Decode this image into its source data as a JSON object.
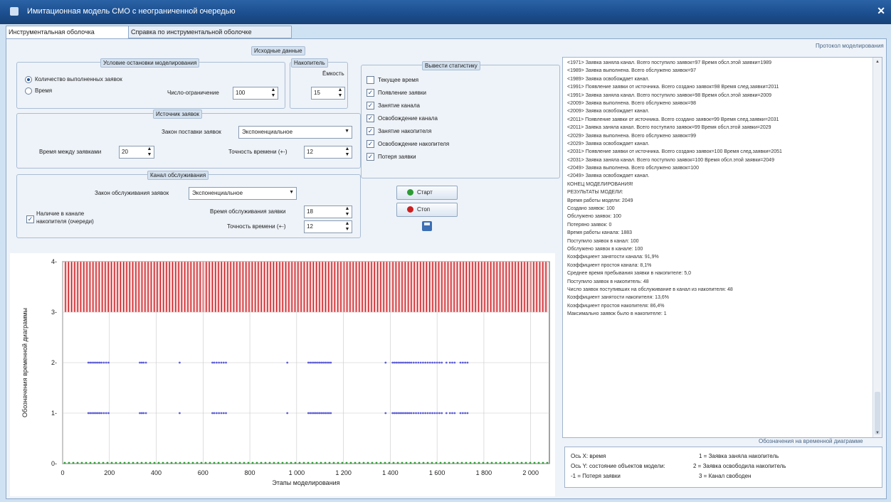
{
  "window": {
    "title": "Имитационная модель СМО с неограниченной очередью",
    "close": "✕"
  },
  "tabs": [
    "Инструментальная оболочка",
    "Справка по инструментальной оболочке"
  ],
  "input_section_title": "Исходные данные",
  "stop_condition": {
    "title": "Условие остановки моделирования",
    "option1": "Количество выполненных заявок",
    "option2": "Время",
    "limit_label": "Число-ограничение",
    "limit_value": "100"
  },
  "accumulator": {
    "title": "Накопитель",
    "capacity_label": "Ёмкость",
    "capacity_value": "15"
  },
  "source": {
    "title": "Источник заявок",
    "law_label": "Закон поставки заявок",
    "law_value": "Экспоненциальное",
    "interval_label": "Время между заявками",
    "interval_value": "20",
    "precision_label": "Точность времени (+-)",
    "precision_value": "12"
  },
  "channel": {
    "title": "Канал обслуживания",
    "law_label": "Закон обслуживания заявок",
    "law_value": "Экспоненциальное",
    "accumulator_check": "Наличие в канале накопителя (очереди)",
    "service_time_label": "Время обслуживания заявки",
    "service_time_value": "18",
    "precision_label": "Точность времени (+-)",
    "precision_value": "12"
  },
  "stats": {
    "title": "Вывести статистику",
    "items": [
      {
        "label": "Текущее время",
        "checked": false
      },
      {
        "label": "Появление заявки",
        "checked": true
      },
      {
        "label": "Занятие канала",
        "checked": true
      },
      {
        "label": "Освобождение канала",
        "checked": true
      },
      {
        "label": "Занятие накопителя",
        "checked": true
      },
      {
        "label": "Освобождение накопителя",
        "checked": true
      },
      {
        "label": "Потеря заявки",
        "checked": true
      }
    ]
  },
  "buttons": {
    "start": "Старт",
    "stop": "Стоп"
  },
  "log": {
    "title": "Протокол моделирования",
    "lines": [
      "<1971> Заявка заняла канал. Всего поступило заявок=97 Время обсл.этой заявки=1989",
      "<1989> Заявка выполнена. Всего обслужено заявок=97",
      "<1989> Заявка освобождает канал.",
      "<1991> Появление заявки от источника. Всего создано заявок=98 Время след.заявки=2011",
      "<1991> Заявка заняла канал. Всего поступило заявок=98 Время обсл.этой заявки=2009",
      "<2009> Заявка выполнена. Всего обслужено заявок=98",
      "<2009> Заявка освобождает канал.",
      "<2011> Появление заявки от источника. Всего создано заявок=99 Время след.заявки=2031",
      "<2011> Заявка заняла канал. Всего поступило заявок=99 Время обсл.этой заявки=2029",
      "<2029> Заявка выполнена. Всего обслужено заявок=99",
      "<2029> Заявка освобождает канал.",
      "<2031> Появление заявки от источника. Всего создано заявок=100 Время след.заявки=2051",
      "<2031> Заявка заняла канал. Всего поступило заявок=100 Время обсл.этой заявки=2049",
      "<2049> Заявка выполнена. Всего обслужено заявок=100",
      "<2049> Заявка освобождает канал.",
      "КОНЕЦ МОДЕЛИРОВАНИЯ!",
      "РЕЗУЛЬТАТЫ МОДЕЛИ:",
      "Время работы модели: 2049",
      "Создано заявок: 100",
      "Обслужено заявок: 100",
      "Потеряно заявок: 0",
      "Время работы канала: 1883",
      "Поступило заявок в канал: 100",
      "Обслужено заявок в канале: 100",
      "Коэффициент занятости канала: 91,9%",
      "Коэффициент простоя канала: 8,1%",
      "Среднее время пребывания заявки в накопителе: 5,0",
      "Поступило заявок в накопитель: 48",
      "Число заявок поступивших на обслуживание в канал из накопителя: 48",
      "Коэффициент занятости накопителя: 13,6%",
      "Коэффициент простоя накопителя: 86,4%",
      "Максимально заявок было в накопителе: 1"
    ]
  },
  "diagram_legend": {
    "title": "Обозначения на временной диаграмме",
    "left": [
      "Ось X: время",
      "Ось Y: состояние объектов модели:",
      "-1 = Потеря заявки"
    ],
    "right": [
      "1 = Заявка заняла накопитель",
      "2 = Заявка освободила накопитель",
      "3 = Канал свободен"
    ]
  },
  "chart_data": {
    "type": "scatter",
    "xlabel": "Этапы моделирования",
    "ylabel": "Обозначения временной диаграммы",
    "xlim": [
      0,
      2080
    ],
    "ylim": [
      0,
      4
    ],
    "x_ticks": [
      "0",
      "200",
      "400",
      "600",
      "800",
      "1 000",
      "1 200",
      "1 400",
      "1 600",
      "1 800",
      "2 000"
    ],
    "y_ticks": [
      "0",
      "1",
      "2",
      "3",
      "4"
    ],
    "grid": true,
    "colors": {
      "channel": "#c9151b",
      "accumulator": "#5f5fd8",
      "zero": "#2f9a35"
    },
    "series": [
      {
        "y": 2,
        "x": [
          110,
          118,
          126,
          134,
          142,
          150,
          158,
          166,
          176,
          186,
          196,
          330,
          338,
          346,
          356,
          500,
          640,
          648,
          658,
          668,
          678,
          688,
          698,
          960,
          1050,
          1058,
          1066,
          1074,
          1082,
          1090,
          1098,
          1106,
          1114,
          1122,
          1130,
          1138,
          1146,
          1380,
          1410,
          1418,
          1426,
          1434,
          1442,
          1450,
          1458,
          1466,
          1474,
          1482,
          1490,
          1500,
          1510,
          1520,
          1530,
          1540,
          1550,
          1560,
          1570,
          1580,
          1590,
          1600,
          1610,
          1620,
          1640,
          1655,
          1665,
          1675,
          1700,
          1710,
          1720,
          1730
        ]
      },
      {
        "y": 1,
        "x": [
          110,
          118,
          126,
          134,
          142,
          150,
          158,
          166,
          176,
          186,
          196,
          330,
          338,
          346,
          356,
          500,
          640,
          648,
          658,
          668,
          678,
          688,
          698,
          960,
          1050,
          1058,
          1066,
          1074,
          1082,
          1090,
          1098,
          1106,
          1114,
          1122,
          1130,
          1138,
          1146,
          1380,
          1410,
          1418,
          1426,
          1434,
          1442,
          1450,
          1458,
          1466,
          1474,
          1482,
          1490,
          1500,
          1510,
          1520,
          1530,
          1540,
          1550,
          1560,
          1570,
          1580,
          1590,
          1600,
          1610,
          1620,
          1640,
          1655,
          1665,
          1675,
          1700,
          1710,
          1720,
          1730
        ]
      }
    ]
  }
}
